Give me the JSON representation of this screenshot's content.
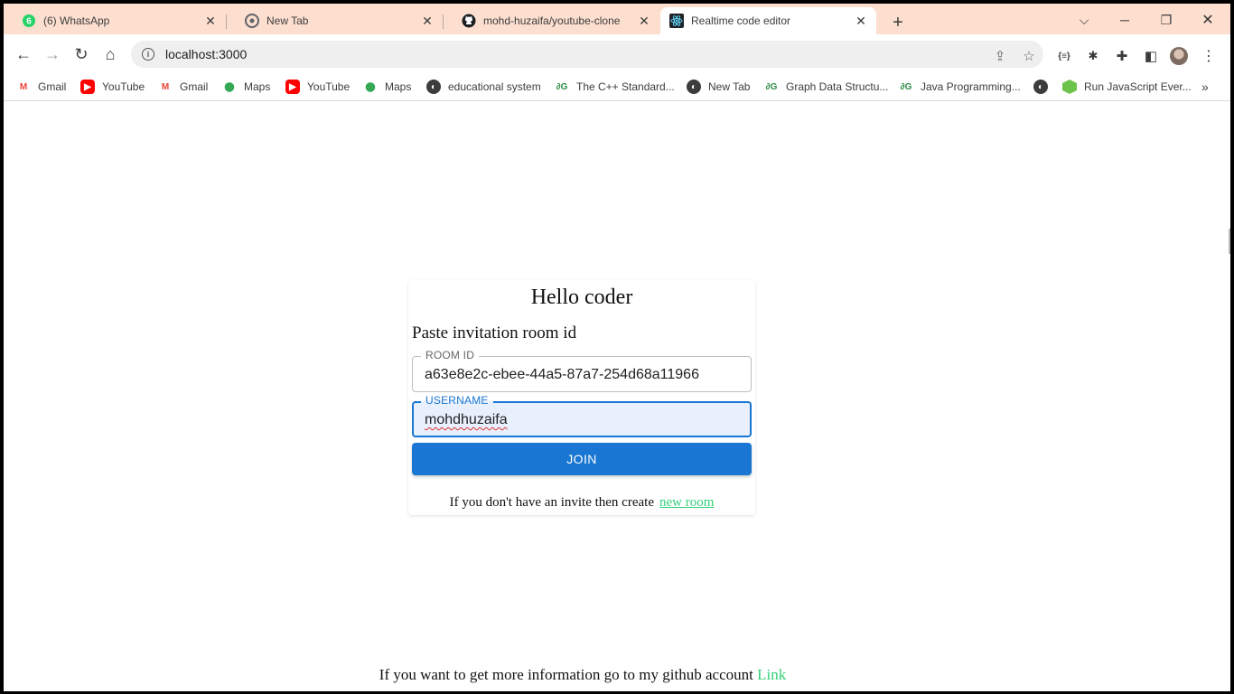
{
  "browser": {
    "tabs": [
      {
        "title": "(6) WhatsApp",
        "badge": "6"
      },
      {
        "title": "New Tab"
      },
      {
        "title": "mohd-huzaifa/youtube-clone"
      },
      {
        "title": "Realtime code editor"
      }
    ],
    "url": "localhost:3000",
    "bookmarks": [
      {
        "label": "Gmail",
        "icon": "gmail-icon"
      },
      {
        "label": "YouTube",
        "icon": "youtube-icon"
      },
      {
        "label": "Gmail",
        "icon": "gmail-icon"
      },
      {
        "label": "Maps",
        "icon": "maps-icon"
      },
      {
        "label": "YouTube",
        "icon": "youtube-icon"
      },
      {
        "label": "Maps",
        "icon": "maps-icon"
      },
      {
        "label": "educational system",
        "icon": "globe-icon"
      },
      {
        "label": "The C++ Standard...",
        "icon": "gfg-icon"
      },
      {
        "label": "New Tab",
        "icon": "globe-icon"
      },
      {
        "label": "Graph Data Structu...",
        "icon": "gfg-icon"
      },
      {
        "label": "Java Programming...",
        "icon": "gfg-icon"
      },
      {
        "label": "",
        "icon": "globe-icon"
      },
      {
        "label": "Run JavaScript Ever...",
        "icon": "nodejs-icon"
      }
    ]
  },
  "page": {
    "title": "Hello coder",
    "subtitle": "Paste invitation room id",
    "room_id": {
      "label": "ROOM ID",
      "value": "a63e8e2c-ebee-44a5-87a7-254d68a11966"
    },
    "username": {
      "label": "USERNAME",
      "value": "mohdhuzaifa"
    },
    "join_label": "JOIN",
    "invite_text": "If you don't have an invite then create",
    "invite_link": "new room",
    "footer_text": "If you want to get more information go to my github account",
    "footer_link": "Link"
  },
  "colors": {
    "tabstrip": "#fddfd0",
    "primary": "#1976d2",
    "link": "#34d17a"
  }
}
